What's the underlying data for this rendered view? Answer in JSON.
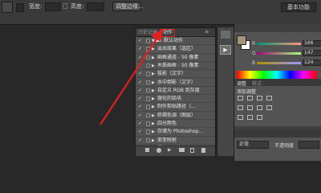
{
  "optionsbar": {
    "width_label": "宽度:",
    "height_label": "高度:",
    "adjust_button": "调整边缘...",
    "workspace_button": "基本功能"
  },
  "actions_panel": {
    "tabs": [
      "历史记录",
      "动作"
    ],
    "active_tab": "动作",
    "set_name": "默认动作",
    "items": [
      "淡出效果（选区）",
      "画框通道 - 50 像素",
      "木质画框 - 50 像素",
      "投影（文字）",
      "水中倒影（文字）",
      "自定义 RGB 到灰度",
      "熔化的铅块",
      "制作剪贴路径（…",
      "棕褐色调（图层）",
      "四分颜色",
      "存储为 Photoshop…",
      "渐变映射",
      "混合器画笔克隆…"
    ]
  },
  "color_panel": {
    "channels": [
      "R",
      "G",
      "B"
    ],
    "values": [
      "166",
      "147",
      "124"
    ]
  },
  "adjustments_panel": {
    "tabs": [
      "调整",
      "样式"
    ],
    "add_label": "添加调整"
  },
  "layers_panel": {
    "mode_label": "正常",
    "opacity_label": "不透明度"
  },
  "colors": {
    "accent_red": "#e02020",
    "foreground": "#a6937c"
  }
}
